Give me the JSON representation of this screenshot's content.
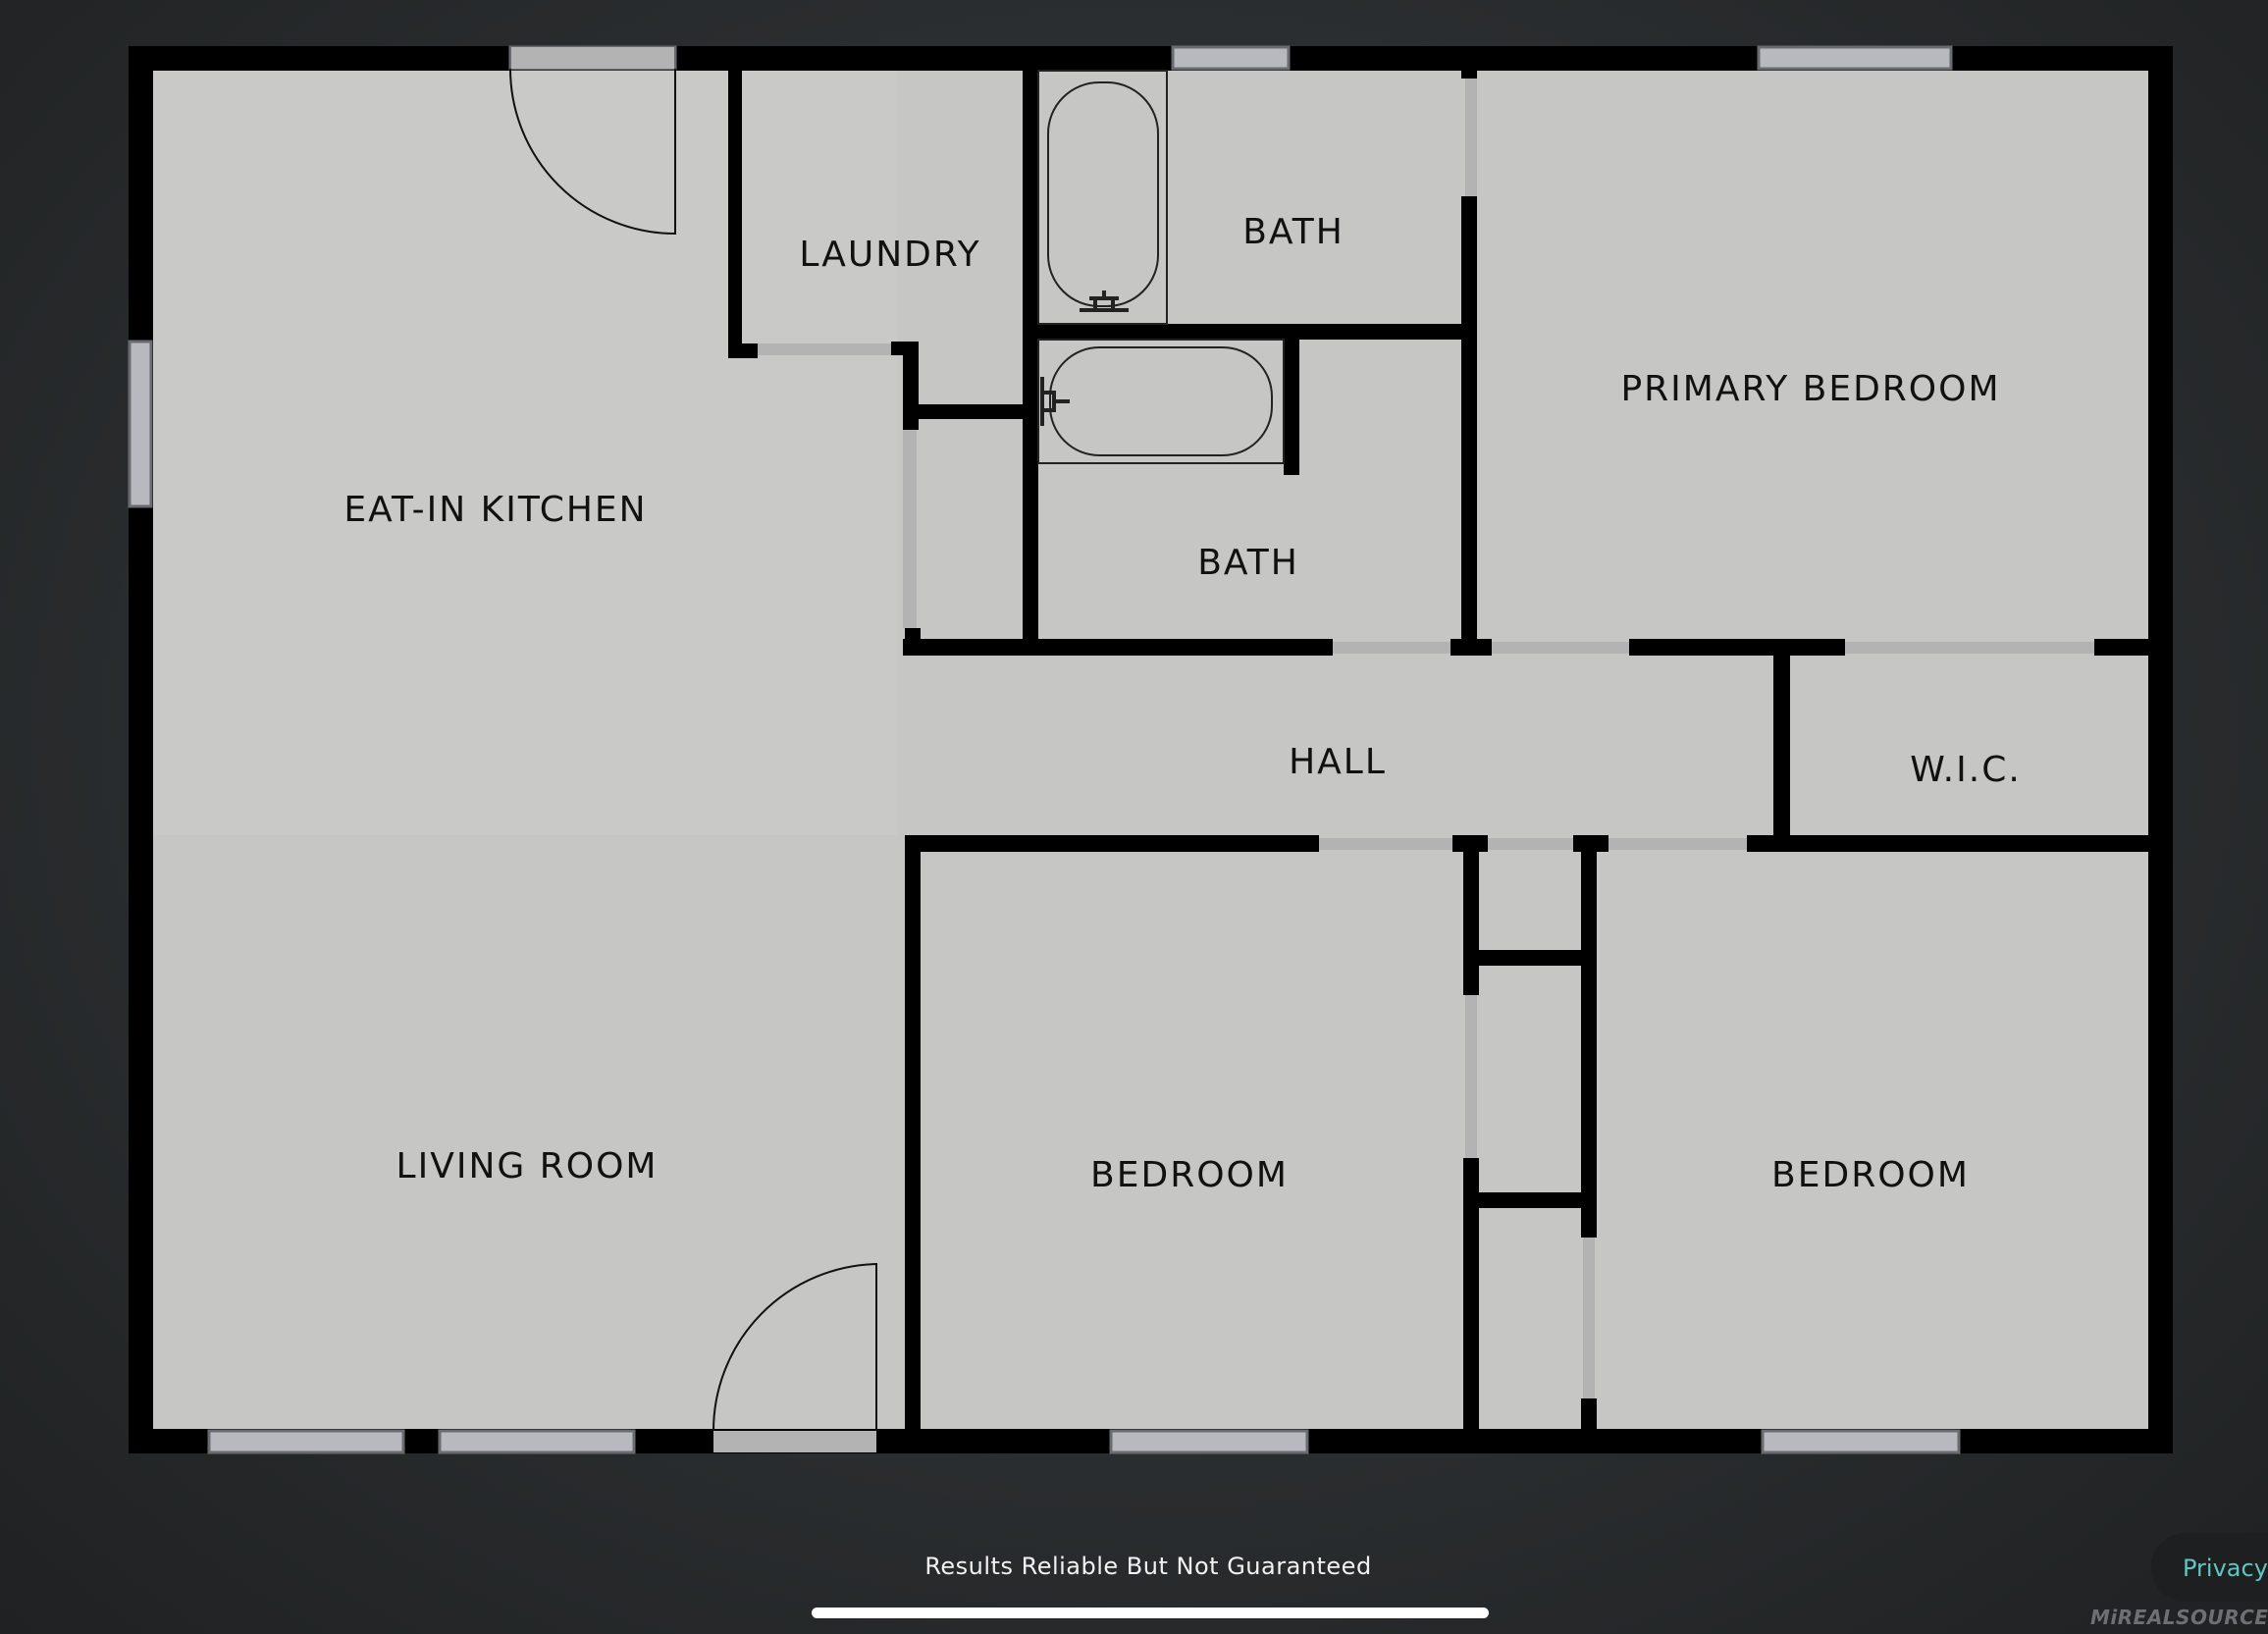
{
  "floor_plan": {
    "rooms": {
      "eat_in_kitchen": "EAT-IN KITCHEN",
      "laundry": "LAUNDRY",
      "bath_upper": "BATH",
      "bath_lower": "BATH",
      "primary_bedroom": "PRIMARY BEDROOM",
      "hall": "HALL",
      "wic": "W.I.C.",
      "living_room": "LIVING ROOM",
      "bedroom_center": "BEDROOM",
      "bedroom_right": "BEDROOM"
    },
    "colors": {
      "floor": "#c6c6c5",
      "wall": "#000000",
      "window_frame": "#b8b9be",
      "background": "#2b2e30"
    }
  },
  "footer": {
    "disclaimer": "Results Reliable But Not Guaranteed",
    "privacy_label": "Privacy",
    "logo_text": "MiREALSOURCE"
  }
}
